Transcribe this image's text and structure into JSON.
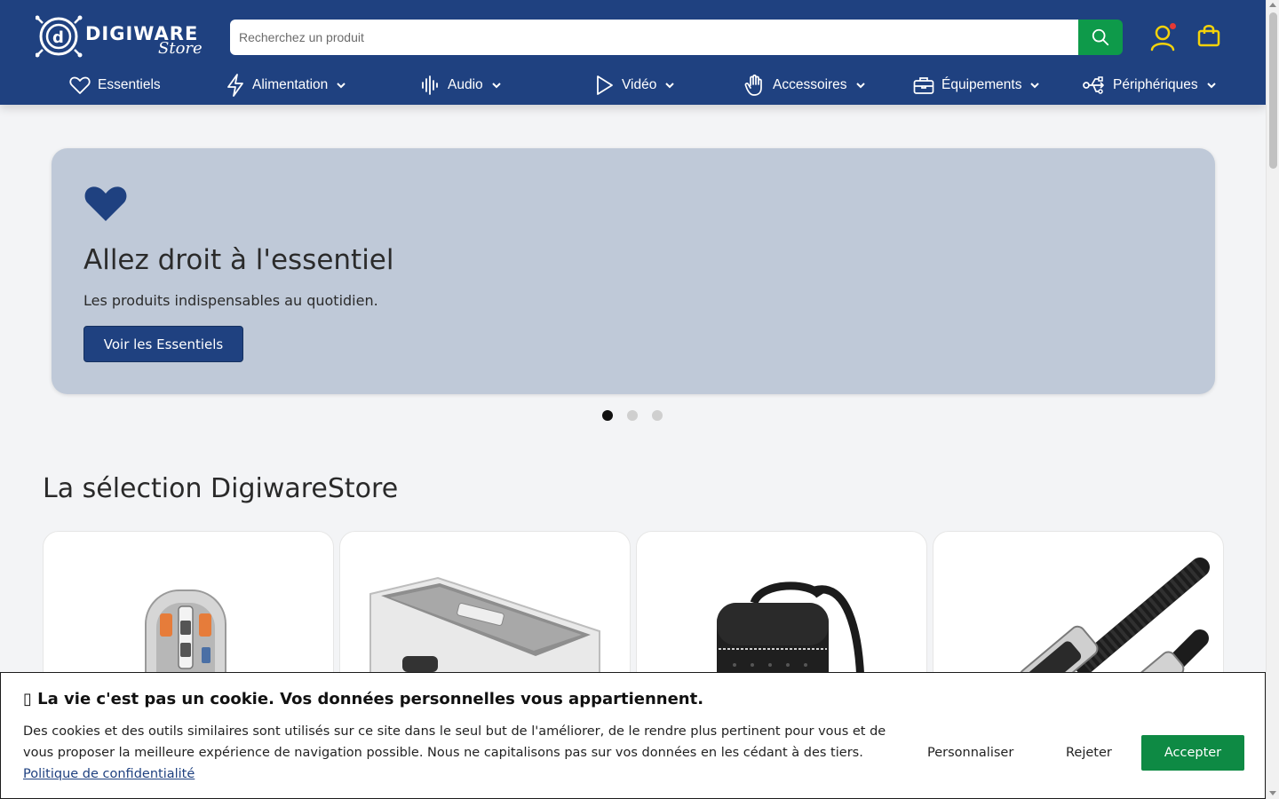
{
  "header": {
    "logo": {
      "text": "DIGIWARE",
      "sub": "Store"
    },
    "search": {
      "placeholder": "Recherchez un produit",
      "value": ""
    },
    "icons": {
      "search": "search-icon",
      "account": "user-icon",
      "cart": "shopping-bag-icon"
    },
    "colors": {
      "background": "#1f4180",
      "accent_green": "#0e9a4a",
      "icon_yellow": "#f5d30a",
      "notification": "#e53935"
    }
  },
  "nav": {
    "items": [
      {
        "label": "Essentiels",
        "icon": "heart-icon",
        "has_dropdown": false
      },
      {
        "label": "Alimentation",
        "icon": "lightning-icon",
        "has_dropdown": true
      },
      {
        "label": "Audio",
        "icon": "soundwave-icon",
        "has_dropdown": true
      },
      {
        "label": "Vidéo",
        "icon": "play-icon",
        "has_dropdown": true
      },
      {
        "label": "Accessoires",
        "icon": "hand-icon",
        "has_dropdown": true
      },
      {
        "label": "Équipements",
        "icon": "briefcase-icon",
        "has_dropdown": true
      },
      {
        "label": "Périphériques",
        "icon": "usb-icon",
        "has_dropdown": true
      }
    ]
  },
  "hero": {
    "icon": "heart-icon",
    "title": "Allez droit à l'essentiel",
    "subtitle": "Les produits indispensables au quotidien.",
    "button_label": "Voir les Essentiels",
    "colors": {
      "background": "#bfc9d8",
      "heart": "#1f4180"
    },
    "carousel": {
      "slides": 3,
      "active": 1
    }
  },
  "selection": {
    "title": "La sélection DigiwareStore",
    "products": [
      {
        "image": "transparent-wireless-mouse"
      },
      {
        "image": "cable-management-box"
      },
      {
        "image": "black-monogram-backpack"
      },
      {
        "image": "braided-hdmi-cable"
      }
    ]
  },
  "cookie_banner": {
    "icon": "cookie-icon",
    "title": "La vie c'est pas un cookie. Vos données personnelles vous appartiennent.",
    "text": "Des cookies et des outils similaires sont utilisés sur ce site dans le seul but de l'améliorer, de le rendre plus pertinent pour vous et de vous proposer la meilleure expérience de navigation possible. Nous ne capitalisons pas sur vos données en les cédant à des tiers.",
    "link_label": "Politique de confidentialité",
    "buttons": {
      "customize": "Personnaliser",
      "reject": "Rejeter",
      "accept": "Accepter"
    },
    "colors": {
      "accept": "#0e8a44"
    }
  }
}
